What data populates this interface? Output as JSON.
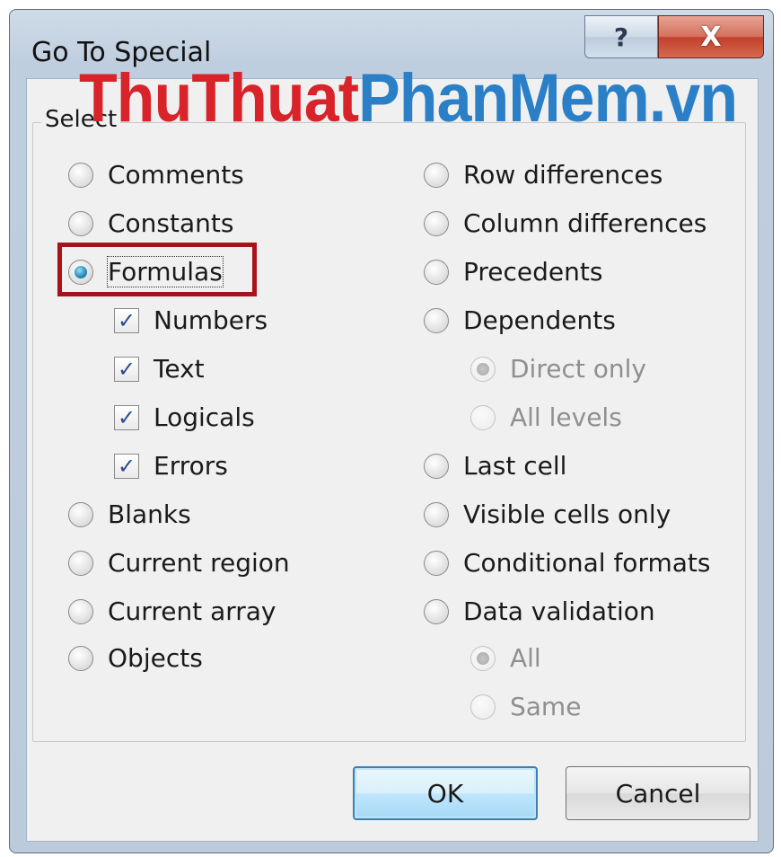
{
  "window": {
    "title": "Go To Special",
    "help_label": "?",
    "close_label": "X"
  },
  "watermark": {
    "part1": "ThuThuat",
    "part2": "PhanMem.vn"
  },
  "group_label": "Select",
  "left_options": [
    {
      "label": "Comments",
      "checked": false
    },
    {
      "label": "Constants",
      "checked": false
    },
    {
      "label": "Formulas",
      "checked": true
    },
    {
      "label": "Blanks",
      "checked": false
    },
    {
      "label": "Current region",
      "checked": false
    },
    {
      "label": "Current array",
      "checked": false
    },
    {
      "label": "Objects",
      "checked": false
    }
  ],
  "formula_types": [
    {
      "label": "Numbers",
      "checked": true
    },
    {
      "label": "Text",
      "checked": true
    },
    {
      "label": "Logicals",
      "checked": true
    },
    {
      "label": "Errors",
      "checked": true
    }
  ],
  "right_options": [
    {
      "label": "Row differences",
      "checked": false
    },
    {
      "label": "Column differences",
      "checked": false
    },
    {
      "label": "Precedents",
      "checked": false
    },
    {
      "label": "Dependents",
      "checked": false
    },
    {
      "label": "Last cell",
      "checked": false
    },
    {
      "label": "Visible cells only",
      "checked": false
    },
    {
      "label": "Conditional formats",
      "checked": false
    },
    {
      "label": "Data validation",
      "checked": false
    }
  ],
  "dependents_sub": [
    {
      "label": "Direct only",
      "checked": true,
      "disabled": true
    },
    {
      "label": "All levels",
      "checked": false,
      "disabled": true
    }
  ],
  "validation_sub": [
    {
      "label": "All",
      "checked": true,
      "disabled": true
    },
    {
      "label": "Same",
      "checked": false,
      "disabled": true
    }
  ],
  "buttons": {
    "ok": "OK",
    "cancel": "Cancel"
  },
  "colors": {
    "highlight": "#a8121a",
    "watermark_red": "#d8232a",
    "watermark_blue": "#2a7fc6",
    "check": "#2b4c8c"
  }
}
